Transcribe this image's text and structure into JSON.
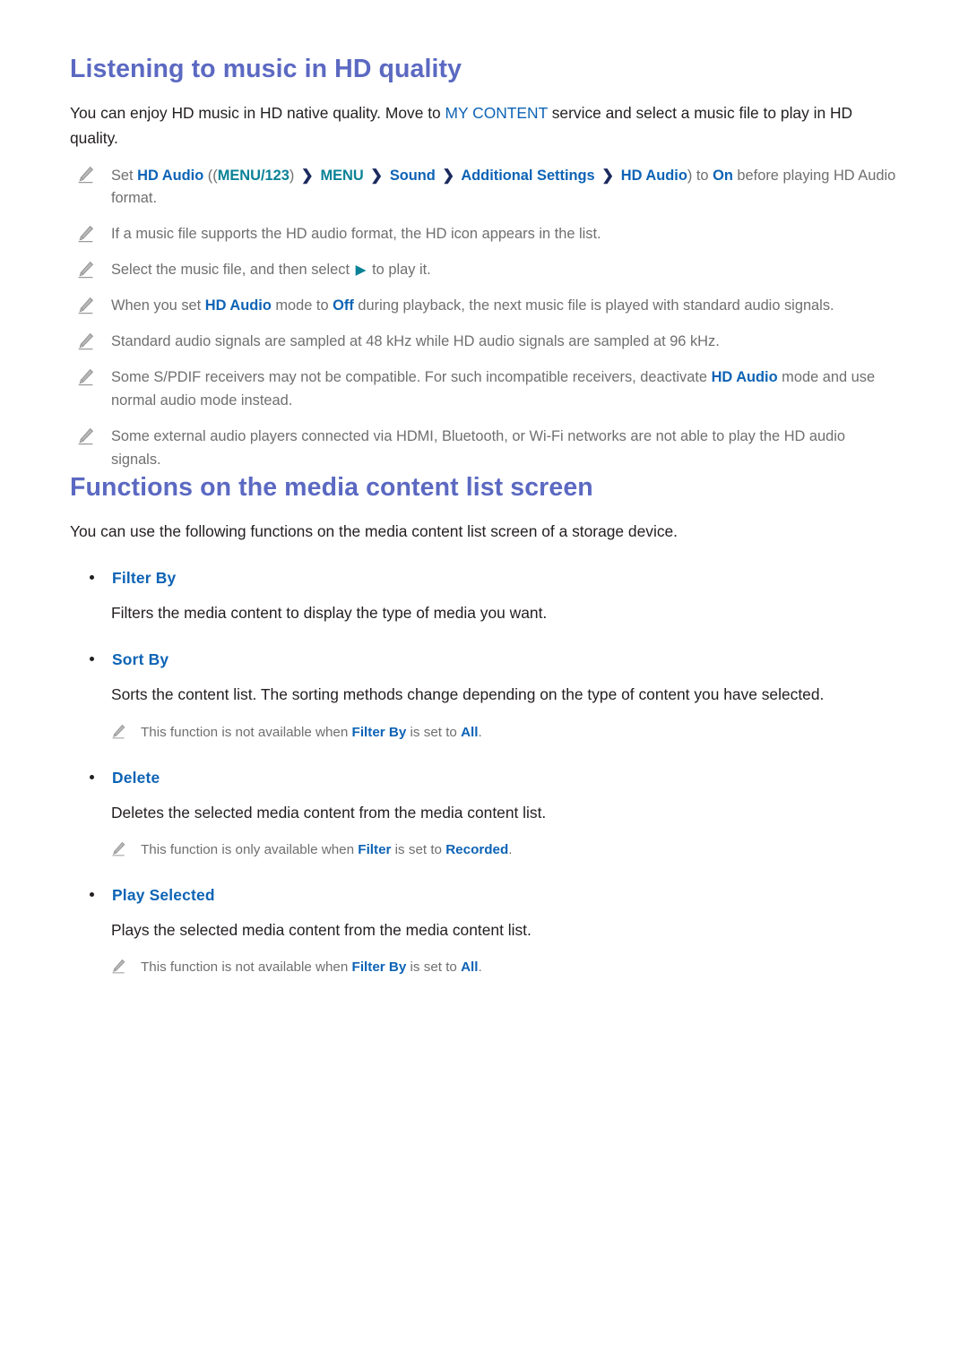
{
  "section1": {
    "title": "Listening to music in HD quality",
    "intro": {
      "part1": "You can enjoy HD music in HD native quality. Move to ",
      "link": "MY CONTENT",
      "part2": " service and select a music file to play in HD quality."
    },
    "notes": [
      {
        "icon": "pencil-icon",
        "segments": [
          {
            "text": "Set ",
            "style": "plain"
          },
          {
            "text": "HD Audio",
            "style": "blue"
          },
          {
            "text": " ((",
            "style": "plain"
          },
          {
            "text": "MENU/123",
            "style": "teal"
          },
          {
            "text": ") ",
            "style": "plain"
          },
          {
            "text": "❯",
            "style": "chevron"
          },
          {
            "text": " MENU ",
            "style": "teal"
          },
          {
            "text": "❯",
            "style": "chevron"
          },
          {
            "text": " Sound ",
            "style": "blue"
          },
          {
            "text": "❯",
            "style": "chevron"
          },
          {
            "text": " Additional Settings ",
            "style": "blue"
          },
          {
            "text": "❯",
            "style": "chevron"
          },
          {
            "text": " HD Audio",
            "style": "blue"
          },
          {
            "text": ") to ",
            "style": "plain"
          },
          {
            "text": "On",
            "style": "blue"
          },
          {
            "text": " before playing HD Audio format.",
            "style": "plain"
          }
        ]
      },
      {
        "icon": "pencil-icon",
        "segments": [
          {
            "text": "If a music file supports the HD audio format, the HD icon appears in the list.",
            "style": "plain"
          }
        ]
      },
      {
        "icon": "pencil-icon",
        "segments": [
          {
            "text": "Select the music file, and then select ",
            "style": "plain"
          },
          {
            "text": "▶",
            "style": "play"
          },
          {
            "text": " to play it.",
            "style": "plain"
          }
        ]
      },
      {
        "icon": "pencil-icon",
        "segments": [
          {
            "text": "When you set ",
            "style": "plain"
          },
          {
            "text": "HD Audio",
            "style": "blue"
          },
          {
            "text": " mode to ",
            "style": "plain"
          },
          {
            "text": "Off",
            "style": "blue"
          },
          {
            "text": " during playback, the next music file is played with standard audio signals.",
            "style": "plain"
          }
        ]
      },
      {
        "icon": "pencil-icon",
        "segments": [
          {
            "text": "Standard audio signals are sampled at 48 kHz while HD audio signals are sampled at 96 kHz.",
            "style": "plain"
          }
        ]
      },
      {
        "icon": "pencil-icon",
        "segments": [
          {
            "text": "Some S/PDIF receivers may not be compatible. For such incompatible receivers, deactivate ",
            "style": "plain"
          },
          {
            "text": "HD Audio",
            "style": "blue"
          },
          {
            "text": " mode and use normal audio mode instead.",
            "style": "plain"
          }
        ]
      },
      {
        "icon": "pencil-icon",
        "segments": [
          {
            "text": "Some external audio players connected via HDMI, Bluetooth, or Wi-Fi networks are not able to play the HD audio signals.",
            "style": "plain"
          }
        ]
      }
    ]
  },
  "section2": {
    "title": "Functions on the media content list screen",
    "intro": "You can use the following functions on the media content list screen of a storage device.",
    "items": [
      {
        "label": "Filter By",
        "description": "Filters the media content to display the type of media you want.",
        "notes": []
      },
      {
        "label": "Sort By",
        "description": "Sorts the content list. The sorting methods change depending on the type of content you have selected.",
        "notes": [
          {
            "icon": "pencil-icon",
            "segments": [
              {
                "text": "This function is not available when ",
                "style": "plain"
              },
              {
                "text": "Filter By",
                "style": "blue"
              },
              {
                "text": " is set to ",
                "style": "plain"
              },
              {
                "text": "All",
                "style": "blue"
              },
              {
                "text": ".",
                "style": "plain"
              }
            ]
          }
        ]
      },
      {
        "label": "Delete",
        "description": "Deletes the selected media content from the media content list.",
        "notes": [
          {
            "icon": "pencil-icon",
            "segments": [
              {
                "text": "This function is only available when ",
                "style": "plain"
              },
              {
                "text": "Filter",
                "style": "blue"
              },
              {
                "text": " is set to ",
                "style": "plain"
              },
              {
                "text": "Recorded",
                "style": "blue"
              },
              {
                "text": ".",
                "style": "plain"
              }
            ]
          }
        ]
      },
      {
        "label": "Play Selected",
        "description": "Plays the selected media content from the media content list.",
        "notes": [
          {
            "icon": "pencil-icon",
            "segments": [
              {
                "text": "This function is not available when ",
                "style": "plain"
              },
              {
                "text": "Filter By",
                "style": "blue"
              },
              {
                "text": " is set to ",
                "style": "plain"
              },
              {
                "text": "All",
                "style": "blue"
              },
              {
                "text": ".",
                "style": "plain"
              }
            ]
          }
        ]
      }
    ]
  },
  "colors": {
    "heading": "#5b69c2",
    "keyword_blue": "#0d63b5",
    "keyword_teal": "#0a8296",
    "body_text": "#231f20",
    "note_text": "#6f6f6f",
    "chevron": "#1b2a5e"
  }
}
